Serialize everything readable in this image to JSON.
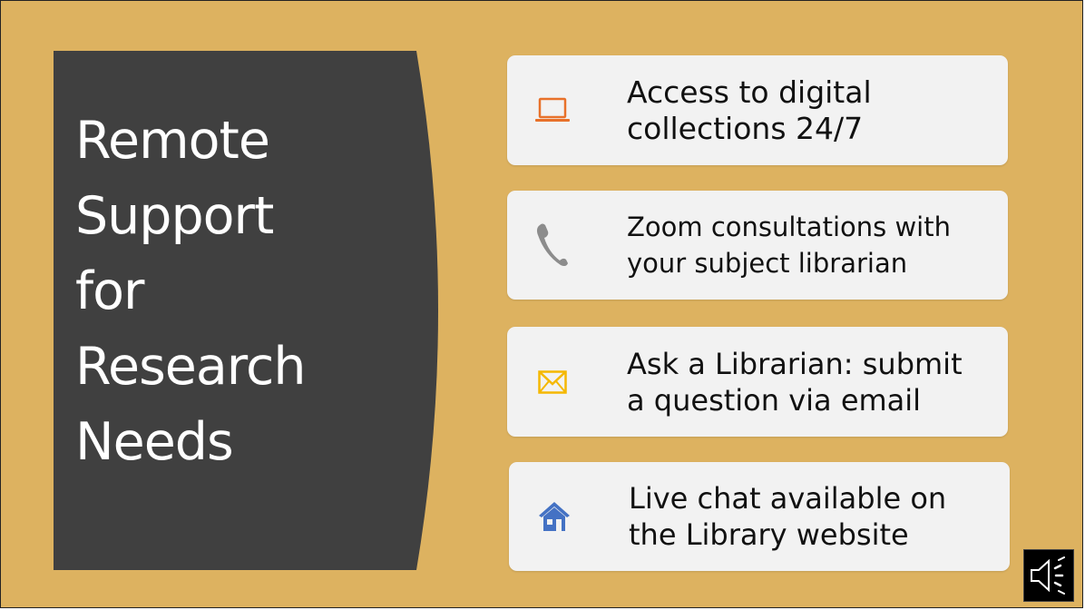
{
  "slide": {
    "background_color": "#DDB260",
    "panel_color": "#404040",
    "title_lines": [
      "Remote",
      "Support",
      "for",
      "Research",
      "Needs"
    ]
  },
  "cards": [
    {
      "icon": "laptop-icon",
      "icon_color": "#E8712A",
      "lines": [
        "Access to digital",
        "collections 24/7"
      ]
    },
    {
      "icon": "phone-icon",
      "icon_color": "#8C8C8C",
      "lines": [
        "Zoom consultations with",
        "your subject librarian"
      ]
    },
    {
      "icon": "envelope-icon",
      "icon_color": "#F5B800",
      "lines": [
        "Ask a Librarian: submit",
        "a question via email"
      ]
    },
    {
      "icon": "house-icon",
      "icon_color": "#4472C4",
      "lines": [
        "Live chat available on",
        "the Library website"
      ]
    }
  ],
  "audio": {
    "icon": "speaker-icon"
  }
}
